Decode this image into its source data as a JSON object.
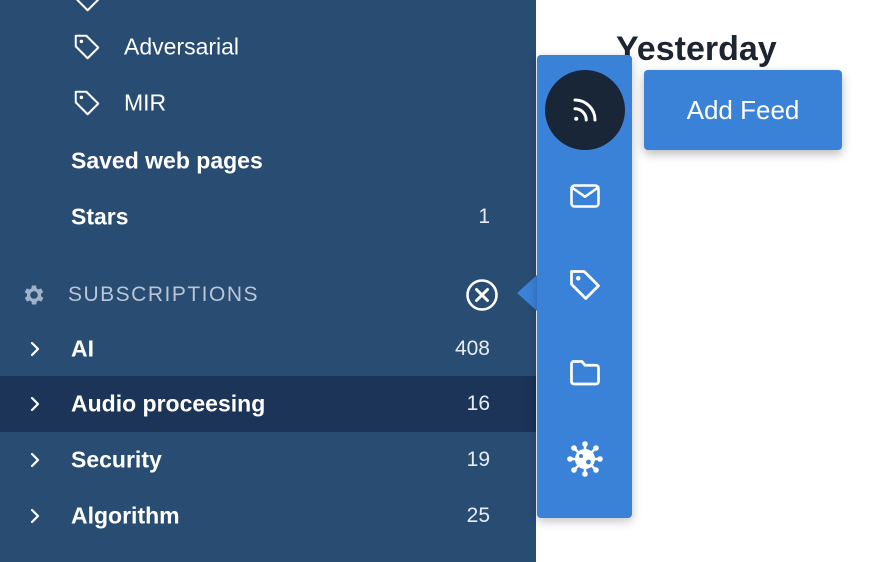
{
  "sidebar": {
    "tags": [
      {
        "label": "Adversarial",
        "icon": "tag-icon"
      },
      {
        "label": "MIR",
        "icon": "tag-icon"
      }
    ],
    "saved_pages": {
      "label": "Saved web pages"
    },
    "stars": {
      "label": "Stars",
      "count": "1"
    },
    "subscriptions": {
      "label": "SUBSCRIPTIONS",
      "settings_icon": "gear-icon",
      "close_icon": "close-circle-icon",
      "items": [
        {
          "label": "AI",
          "count": "408"
        },
        {
          "label": "Audio proceesing",
          "count": "16",
          "selected": true
        },
        {
          "label": "Security",
          "count": "19"
        },
        {
          "label": "Algorithm",
          "count": "25"
        }
      ]
    }
  },
  "main": {
    "title": "Yesterday"
  },
  "add_menu": {
    "items": [
      {
        "name": "rss-icon",
        "active": true
      },
      {
        "name": "mail-icon"
      },
      {
        "name": "tag-icon"
      },
      {
        "name": "folder-icon"
      },
      {
        "name": "bug-icon"
      }
    ],
    "tooltip": "Add Feed"
  },
  "colors": {
    "sidebar_bg": "#294c73",
    "selected_bg": "#1b3458",
    "accent": "#3a82d8",
    "active_button": "#182638"
  }
}
